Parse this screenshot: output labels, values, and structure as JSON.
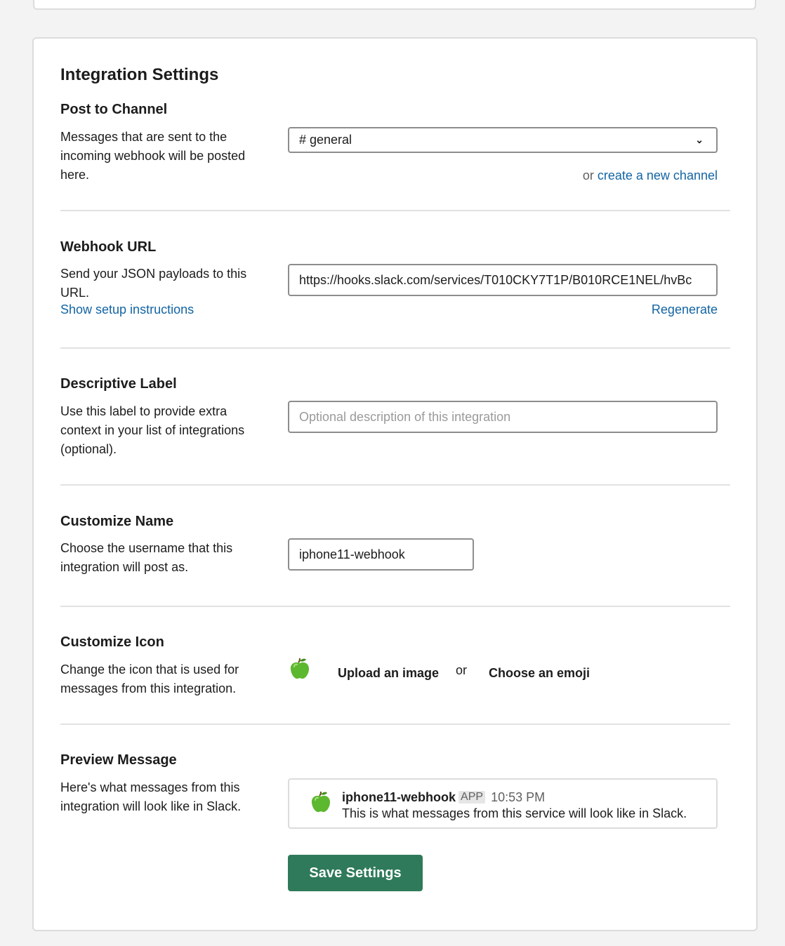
{
  "page": {
    "title": "Integration Settings"
  },
  "post_to_channel": {
    "title": "Post to Channel",
    "description": "Messages that are sent to the incoming webhook will be posted here.",
    "selected_channel": "# general",
    "or_text": "or",
    "create_channel_link": "create a new channel"
  },
  "webhook_url": {
    "title": "Webhook URL",
    "description": "Send your JSON payloads to this URL.",
    "setup_link": "Show setup instructions",
    "value": "https://hooks.slack.com/services/T010CKY7T1P/B010RCE1NEL/hvBc",
    "regenerate_link": "Regenerate"
  },
  "descriptive_label": {
    "title": "Descriptive Label",
    "description": "Use this label to provide extra context in your list of integrations (optional).",
    "placeholder": "Optional description of this integration"
  },
  "customize_name": {
    "title": "Customize Name",
    "description": "Choose the username that this integration will post as.",
    "value": "iphone11-webhook"
  },
  "customize_icon": {
    "title": "Customize Icon",
    "description": "Change the icon that is used for messages from this integration.",
    "icon": "green-apple-icon",
    "upload_link": "Upload an image",
    "or_text": "or",
    "emoji_link": "Choose an emoji"
  },
  "preview_message": {
    "title": "Preview Message",
    "description": "Here's what messages from this integration will look like in Slack.",
    "username": "iphone11-webhook",
    "badge": "APP",
    "time": "10:53 PM",
    "text": "This is what messages from this service will look like in Slack."
  },
  "save_button": "Save Settings",
  "colors": {
    "link": "#1264a3",
    "save_button_bg": "#2f7a5a",
    "apple": "#5cb82f"
  }
}
